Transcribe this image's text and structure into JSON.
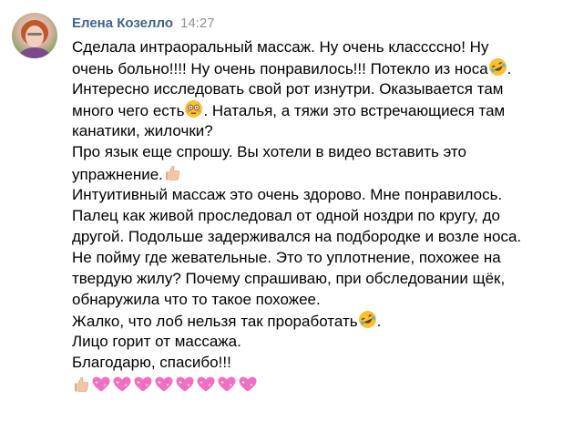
{
  "post": {
    "author": "Елена Козелло",
    "time": "14:27"
  },
  "message": {
    "lines": [
      "Сделала интраоральный массаж. Ну очень класссcно! Ну",
      "очень больно!!!! Ну очень понравилось!!! Потекло из носа",
      "Интересно исследовать свой рот изнутри. Оказывается там",
      "много чего есть",
      ". Наталья, а тяжи это встречающиеся там",
      "канатики, жилочки?",
      "Про язык еще спрошу. Вы хотели в видео вставить это",
      "упражнение.",
      "Интуитивный массаж это очень здорово. Мне понравилось.",
      "Палец как живой проследовал от одной ноздри по кругу, до",
      "другой. Подольше задерживался на подбородке и возле носа.",
      "Не пойму где жевательные. Это то уплотнение, похожее на",
      "твердую жилу? Почему спрашиваю, при обследовании щёк,",
      "обнаружила что то такое похожее.",
      "Жалко, что лоб нельзя так проработать",
      ".",
      "Лицо горит от массажа.",
      "Благодарю, спасибо!!!"
    ]
  },
  "emojis": {
    "rofl": "rolling-on-floor-laughing-emoji",
    "flushed": "flushed-face-emoji",
    "thumbs_up": "thumbs-up-emoji",
    "sparkling_heart": "sparkling-heart-emoji",
    "heart_count": 8
  },
  "colors": {
    "author": "#42648b",
    "time": "#939393",
    "text": "#000000",
    "background": "#ffffff"
  }
}
